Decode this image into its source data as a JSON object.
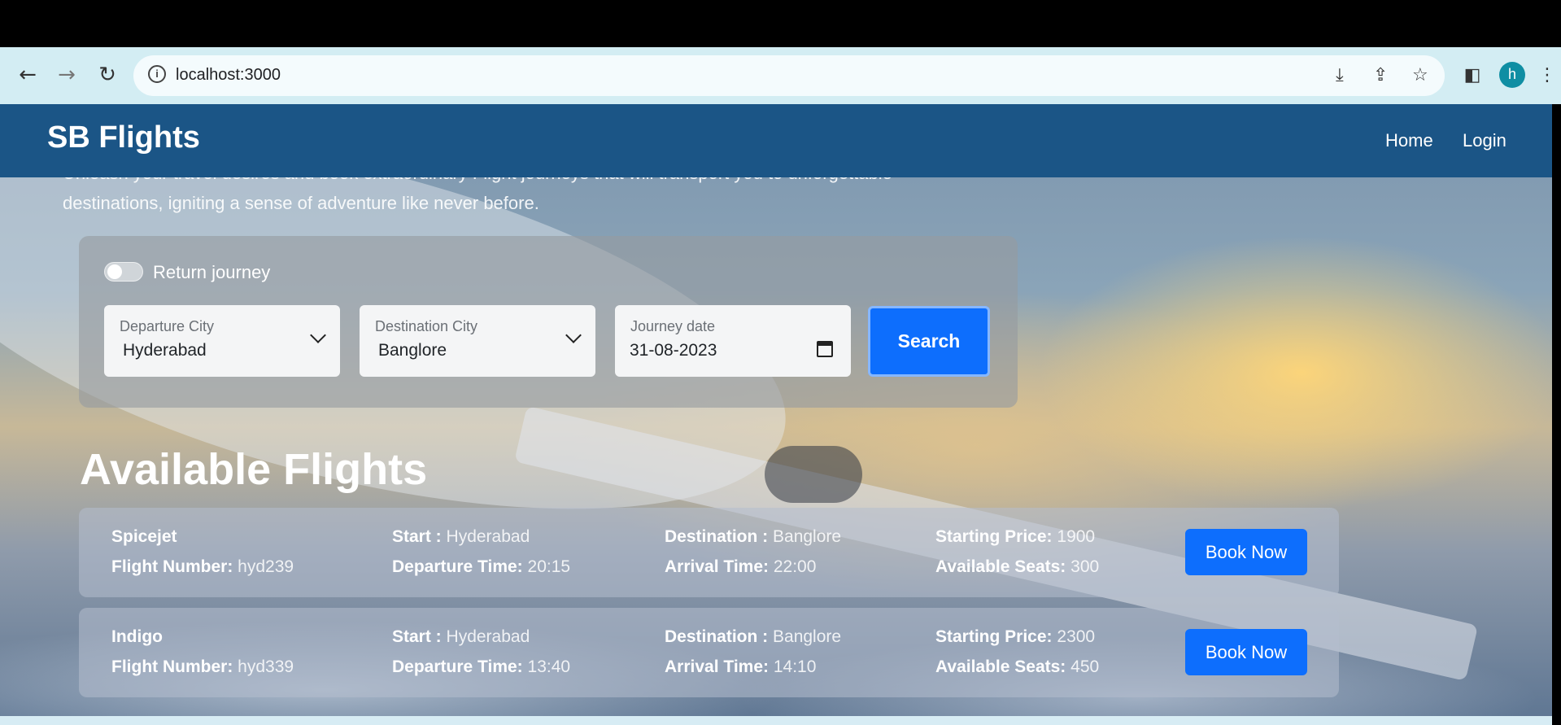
{
  "browser": {
    "url": "localhost:3000",
    "profile_initial": "h"
  },
  "navbar": {
    "brand": "SB Flights",
    "links": [
      "Home",
      "Login"
    ]
  },
  "hero": {
    "tagline_line1": "Unleash your travel desires and book extraordinary Flight journeys that will transport you to unforgettable",
    "tagline_line2": "destinations, igniting a sense of adventure like never before."
  },
  "search": {
    "return_label": "Return journey",
    "return_checked": false,
    "departure_label": "Departure City",
    "departure_value": "Hyderabad",
    "destination_label": "Destination City",
    "destination_value": "Banglore",
    "date_label": "Journey date",
    "date_value": "31-08-2023",
    "button": "Search"
  },
  "results": {
    "title": "Available Flights",
    "labels": {
      "flight_number": "Flight Number:",
      "start": "Start :",
      "departure_time": "Departure Time:",
      "destination": "Destination :",
      "arrival_time": "Arrival Time:",
      "starting_price": "Starting Price:",
      "available_seats": "Available Seats:"
    },
    "book_label": "Book Now",
    "flights": [
      {
        "name": "Spicejet",
        "number": "hyd239",
        "start": "Hyderabad",
        "departure_time": "20:15",
        "destination": "Banglore",
        "arrival_time": "22:00",
        "price": "1900",
        "seats": "300"
      },
      {
        "name": "Indigo",
        "number": "hyd339",
        "start": "Hyderabad",
        "departure_time": "13:40",
        "destination": "Banglore",
        "arrival_time": "14:10",
        "price": "2300",
        "seats": "450"
      }
    ]
  }
}
